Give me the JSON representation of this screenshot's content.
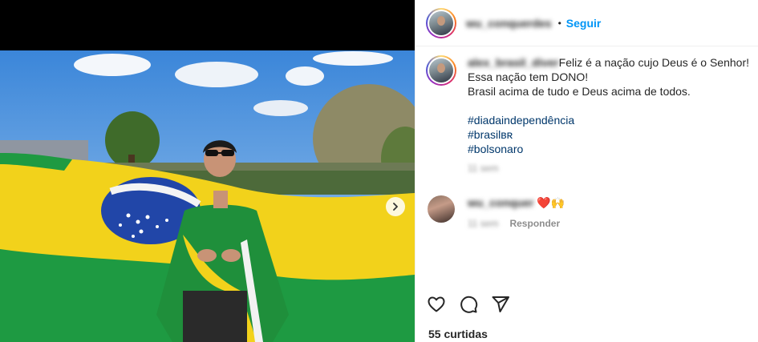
{
  "post": {
    "username_header": "wu_conquerdes",
    "dot": "•",
    "follow_label": "Seguir"
  },
  "caption": {
    "username": "alex_brasil_diver",
    "line1": "Feliz é a nação cujo Deus é o Senhor!",
    "line2": "Essa nação tem DONO!",
    "line3": "Brasil acima de tudo e Deus acima de todos.",
    "hashtags": [
      "#diadaindependência",
      "#brasilʙʀ",
      "#bolsonaro"
    ],
    "time": "11 sem"
  },
  "comment": {
    "username": "wu_conquer",
    "text": "❤️🙌",
    "time": "11 sem",
    "reply_label": "Responder"
  },
  "likes": "55 curtidas",
  "icons": {
    "like": "heart-icon",
    "comment": "comment-icon",
    "share": "paper-plane-icon",
    "next": "chevron-right-icon"
  },
  "colors": {
    "link": "#00376b",
    "follow": "#0095f6",
    "heart": "#ed4956",
    "flag_green": "#1e9a42",
    "flag_yellow": "#f2d21b",
    "flag_blue": "#2146a8"
  }
}
